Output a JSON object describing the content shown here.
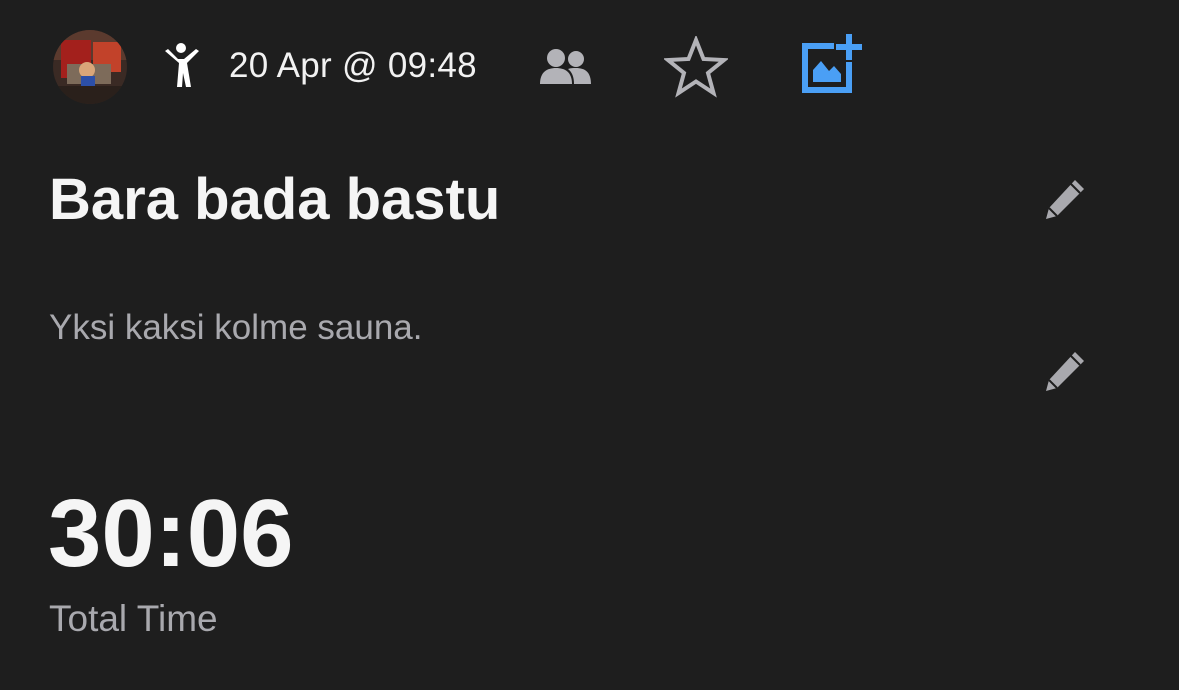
{
  "header": {
    "avatar_icon": "user-avatar-photo",
    "activity_icon": "person-exercise-icon",
    "date_time": "20 Apr @ 09:48",
    "people_icon": "people-icon",
    "star_icon": "star-outline-icon",
    "add_photo_icon": "add-photo-icon",
    "accent_color": "#4a9ff5"
  },
  "activity": {
    "title": "Bara bada bastu",
    "description": "Yksi kaksi kolme sauna.",
    "edit_icon": "pencil-icon"
  },
  "stats": {
    "total_time_value": "30:06",
    "total_time_label": "Total Time"
  }
}
